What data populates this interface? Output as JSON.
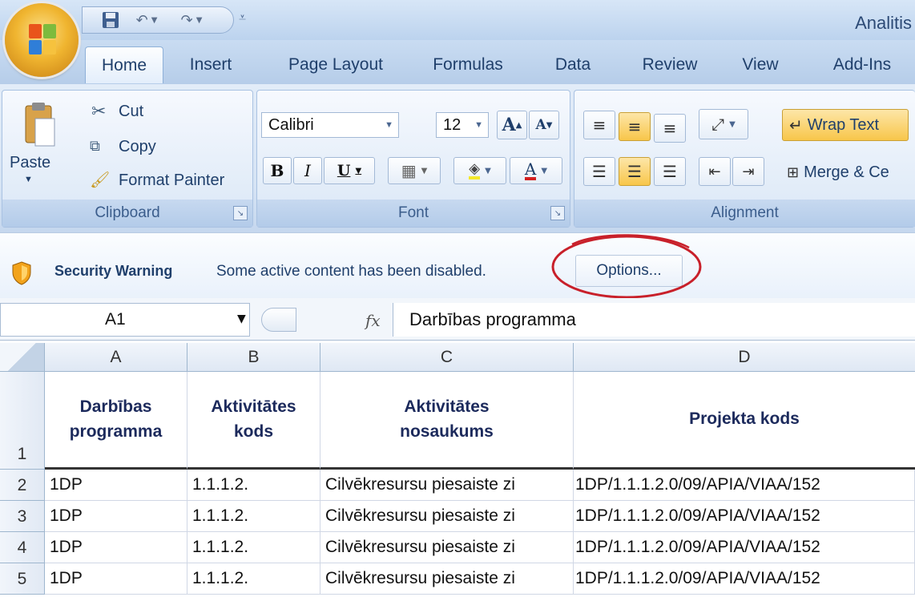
{
  "window": {
    "title": "Analitis"
  },
  "quick_access": {
    "items": [
      "save-icon",
      "undo-icon",
      "redo-icon"
    ]
  },
  "tabs": [
    {
      "label": "Home",
      "active": true
    },
    {
      "label": "Insert"
    },
    {
      "label": "Page Layout"
    },
    {
      "label": "Formulas"
    },
    {
      "label": "Data"
    },
    {
      "label": "Review"
    },
    {
      "label": "View"
    },
    {
      "label": "Add-Ins"
    }
  ],
  "clipboard": {
    "paste": "Paste",
    "cut": "Cut",
    "copy": "Copy",
    "format_painter": "Format Painter",
    "group_label": "Clipboard"
  },
  "font": {
    "family": "Calibri",
    "size": "12",
    "grow": "A",
    "shrink": "A",
    "bold": "B",
    "italic": "I",
    "underline": "U",
    "font_color": "A",
    "group_label": "Font"
  },
  "alignment": {
    "wrap_text": "Wrap Text",
    "merge": "Merge & Ce",
    "group_label": "Alignment"
  },
  "security": {
    "title": "Security Warning",
    "message": "Some active content has been disabled.",
    "options_button": "Options..."
  },
  "formula_bar": {
    "name_box": "A1",
    "fx": "fx",
    "formula": "Darbības programma"
  },
  "sheet": {
    "columns": [
      "A",
      "B",
      "C",
      "D"
    ],
    "header_row": {
      "number": "1",
      "A": [
        "Darbības",
        "programma"
      ],
      "B": [
        "Aktivitātes",
        "kods"
      ],
      "C": [
        "Aktivitātes",
        "nosaukums"
      ],
      "D": [
        "Projekta kods"
      ]
    },
    "rows": [
      {
        "number": "2",
        "A": "1DP",
        "B": "1.1.1.2.",
        "C": "Cilvēkresursu piesaiste zi",
        "D": "1DP/1.1.1.2.0/09/APIA/VIAA/152"
      },
      {
        "number": "3",
        "A": "1DP",
        "B": "1.1.1.2.",
        "C": "Cilvēkresursu piesaiste zi",
        "D": "1DP/1.1.1.2.0/09/APIA/VIAA/152"
      },
      {
        "number": "4",
        "A": "1DP",
        "B": "1.1.1.2.",
        "C": "Cilvēkresursu piesaiste zi",
        "D": "1DP/1.1.1.2.0/09/APIA/VIAA/152"
      },
      {
        "number": "5",
        "A": "1DP",
        "B": "1.1.1.2.",
        "C": "Cilvēkresursu piesaiste zi",
        "D": "1DP/1.1.1.2.0/09/APIA/VIAA/152"
      }
    ]
  },
  "colors": {
    "ribbon": "#d5e3f4",
    "title_text": "#1f3f6b",
    "annotation": "#c8202a"
  }
}
